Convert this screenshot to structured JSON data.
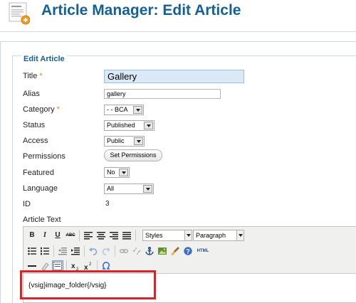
{
  "header": {
    "title": "Article Manager: Edit Article",
    "icon": "article-add-icon"
  },
  "form": {
    "legend": "Edit Article",
    "required_marker": "*",
    "title": {
      "label": "Title",
      "value": "Gallery",
      "required": true
    },
    "alias": {
      "label": "Alias",
      "value": "gallery"
    },
    "category": {
      "label": "Category",
      "value": "- - BCA",
      "required": true
    },
    "status": {
      "label": "Status",
      "value": "Published"
    },
    "access": {
      "label": "Access",
      "value": "Public"
    },
    "permissions": {
      "label": "Permissions",
      "button_label": "Set Permissions"
    },
    "featured": {
      "label": "Featured",
      "value": "No"
    },
    "language": {
      "label": "Language",
      "value": "All"
    },
    "id": {
      "label": "ID",
      "value": "3"
    },
    "article_text": {
      "label": "Article Text"
    }
  },
  "editor": {
    "styles_select": "Styles",
    "format_select": "Paragraph",
    "content": "{vsig}image_folder{/vsig}",
    "buttons_row1": [
      "B",
      "I",
      "U",
      "ABC"
    ],
    "html_label": "HTML",
    "highlight_color": "#d9232b"
  },
  "colors": {
    "title": "#146295",
    "required": "#e8821c",
    "title_input_bg": "#dbe9f6"
  }
}
